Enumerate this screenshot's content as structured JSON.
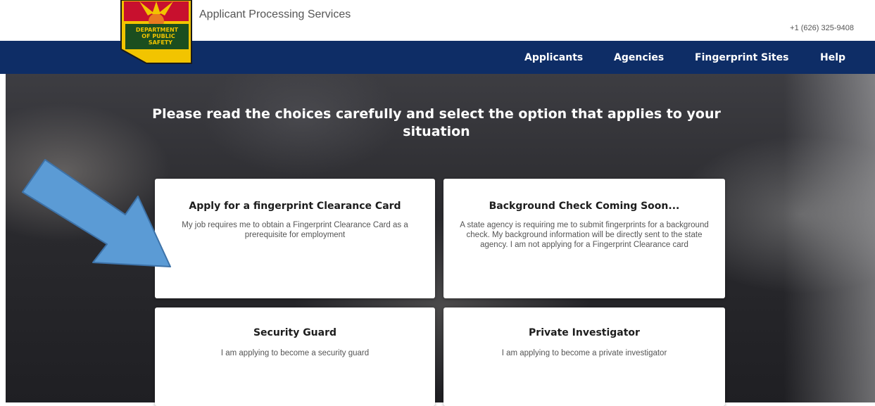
{
  "header": {
    "service_name": "Applicant Processing Services",
    "phone": "+1 (626) 325-9408",
    "logo_text": [
      "DEPARTMENT",
      "OF PUBLIC",
      "SAFETY"
    ]
  },
  "nav": {
    "items": [
      "Applicants",
      "Agencies",
      "Fingerprint Sites",
      "Help"
    ]
  },
  "main": {
    "heading": "Please read the choices carefully and select the option that applies to your situation",
    "cards": [
      {
        "title": "Apply for a fingerprint Clearance Card",
        "description": "My job requires me to obtain a Fingerprint Clearance Card as a prerequisite for employment"
      },
      {
        "title": "Background Check Coming Soon...",
        "description": "A state agency is requiring me to submit fingerprints for a background check. My background information will be directly sent to the state agency. I am not applying for a Fingerprint Clearance card"
      },
      {
        "title": "Security Guard",
        "description": "I am applying to become a security guard"
      },
      {
        "title": "Private Investigator",
        "description": "I am applying to become a private investigator"
      }
    ]
  },
  "colors": {
    "navbar": "#0e2d66",
    "arrow": "#5b9bd5",
    "logo_yellow": "#f2c400",
    "logo_red": "#c8102e"
  }
}
